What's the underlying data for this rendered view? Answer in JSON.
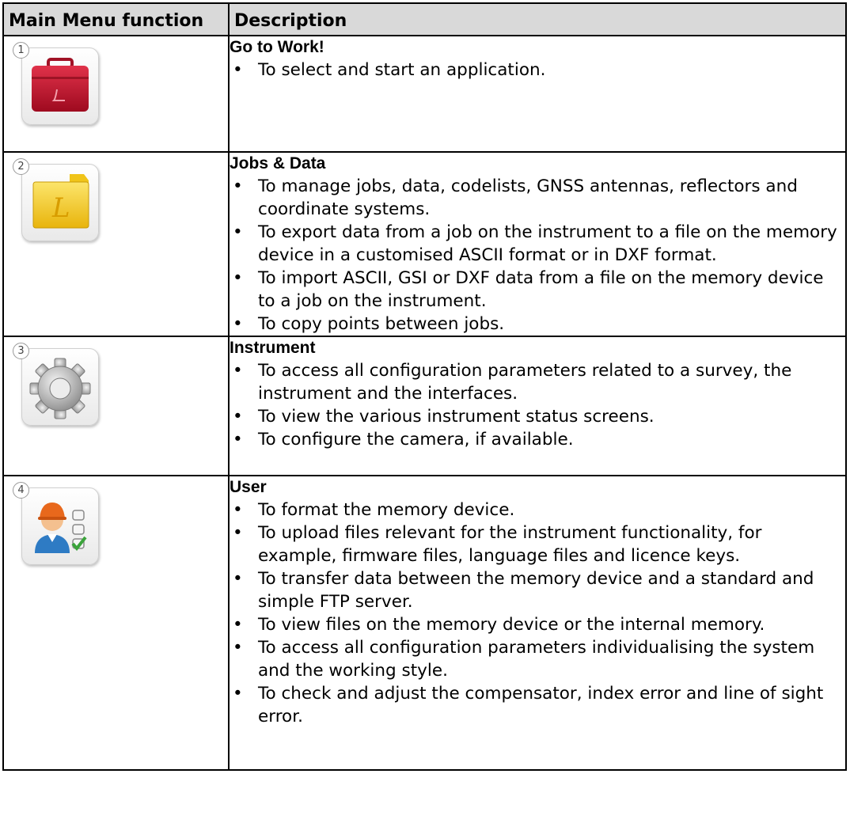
{
  "table": {
    "headers": [
      "Main Menu function",
      "Description"
    ],
    "rows": [
      {
        "number": "1",
        "icon": "toolbox-icon",
        "title": "Go to Work!",
        "items": [
          "To select and start an application."
        ]
      },
      {
        "number": "2",
        "icon": "folder-icon",
        "title": "Jobs & Data",
        "items": [
          "To manage jobs, data, codelists, GNSS antennas, reflectors and coordinate systems.",
          "To export data from a job on the instrument to a file on the memory device in a customised ASCII format or in DXF format.",
          "To import ASCII, GSI or DXF data from a file on the memory device to a job on the instrument.",
          "To copy points between jobs."
        ]
      },
      {
        "number": "3",
        "icon": "gear-icon",
        "title": "Instrument",
        "items": [
          "To access all configuration parameters related to a survey, the instrument and the interfaces.",
          "To view the various instrument status screens.",
          "To configure the camera, if available."
        ]
      },
      {
        "number": "4",
        "icon": "user-icon",
        "title": "User",
        "items": [
          "To format the memory device.",
          "To upload files relevant for the instrument functionality, for example, firmware files, language files and licence keys.",
          "To transfer data between the memory device and a standard and simple FTP server.",
          "To view files on the memory device or the internal memory.",
          "To access all configuration parameters individualising the system and the working style.",
          "To check and adjust the compensator, index error and line of sight error."
        ]
      }
    ]
  }
}
